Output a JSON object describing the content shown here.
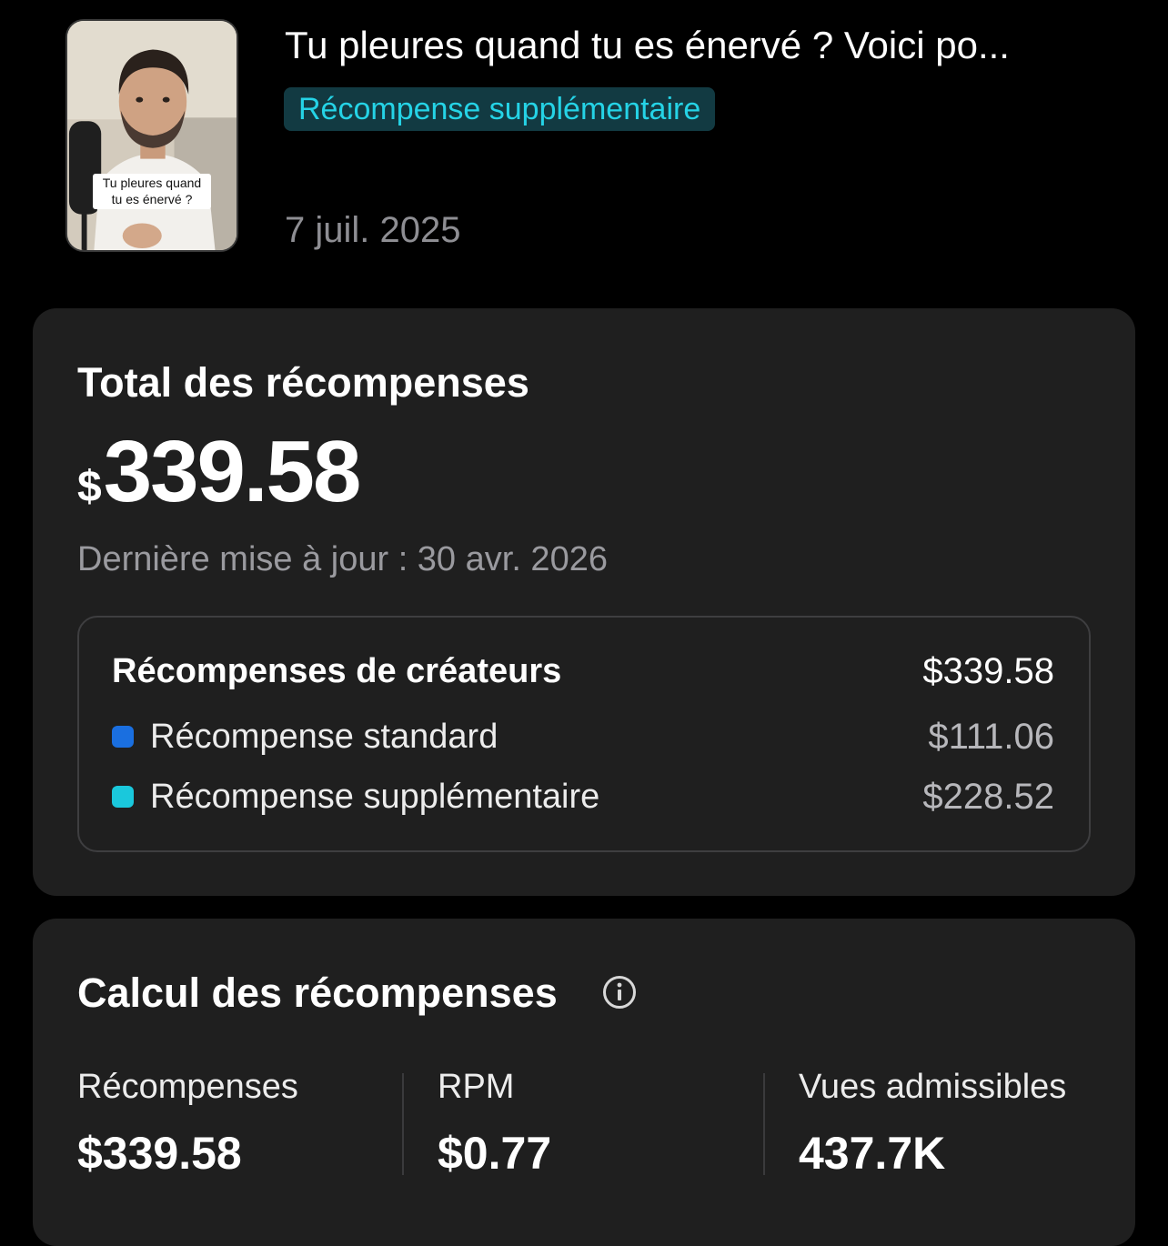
{
  "video": {
    "title": "Tu pleures quand tu es énervé ? Voici po...",
    "tag": "Récompense supplémentaire",
    "date": "7 juil. 2025",
    "thumbnail_caption": "Tu pleures quand\ntu es énervé ?"
  },
  "total": {
    "title": "Total des récompenses",
    "currency": "$",
    "amount": "339.58",
    "last_updated": "Dernière mise à jour : 30 avr. 2026",
    "breakdown": {
      "header_label": "Récompenses de créateurs",
      "header_value": "$339.58",
      "items": [
        {
          "label": "Récompense standard",
          "value": "$111.06",
          "color": "#1a6fe0"
        },
        {
          "label": "Récompense supplémentaire",
          "value": "$228.52",
          "color": "#1ac8dc"
        }
      ]
    }
  },
  "calculation": {
    "title": "Calcul des récompenses",
    "metrics": [
      {
        "label": "Récompenses",
        "value": "$339.58"
      },
      {
        "label": "RPM",
        "value": "$0.77"
      },
      {
        "label": "Vues admissibles",
        "value": "437.7K"
      }
    ]
  },
  "colors": {
    "background": "#000000",
    "card": "#1f1f1f",
    "tag_background": "#123a42",
    "tag_text": "#25d3e6",
    "muted_text": "#9a9a9f"
  },
  "icons": {
    "info": "info-circle-icon"
  }
}
